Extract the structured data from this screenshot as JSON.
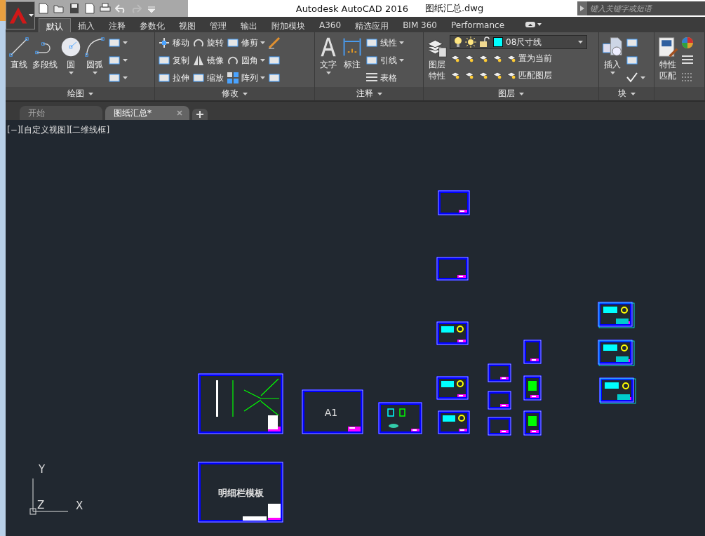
{
  "window": {
    "title": "Autodesk AutoCAD 2016",
    "file_name": "图纸汇总.dwg"
  },
  "search": {
    "placeholder": "键入关键字或短语"
  },
  "ribbon_tabs": [
    {
      "label": "默认",
      "selected": true
    },
    {
      "label": "插入",
      "selected": false
    },
    {
      "label": "注释",
      "selected": false
    },
    {
      "label": "参数化",
      "selected": false
    },
    {
      "label": "视图",
      "selected": false
    },
    {
      "label": "管理",
      "selected": false
    },
    {
      "label": "输出",
      "selected": false
    },
    {
      "label": "附加模块",
      "selected": false
    },
    {
      "label": "A360",
      "selected": false
    },
    {
      "label": "精选应用",
      "selected": false
    },
    {
      "label": "BIM 360",
      "selected": false
    },
    {
      "label": "Performance",
      "selected": false
    }
  ],
  "panels": [
    {
      "title": "绘图",
      "tools": [
        {
          "kind": "large",
          "label": "直线",
          "dropdown": false
        },
        {
          "kind": "large",
          "label": "多段线",
          "dropdown": false
        },
        {
          "kind": "large",
          "label": "圆",
          "dropdown": true
        },
        {
          "kind": "large",
          "label": "圆弧",
          "dropdown": true
        },
        {
          "kind": "icon",
          "dropdown": true
        },
        {
          "kind": "icon",
          "dropdown": true
        },
        {
          "kind": "icon",
          "dropdown": true
        }
      ]
    },
    {
      "title": "修改",
      "tools": [
        {
          "kind": "small",
          "label": "移动",
          "dropdown": false
        },
        {
          "kind": "small",
          "label": "复制",
          "dropdown": false
        },
        {
          "kind": "small",
          "label": "拉伸",
          "dropdown": false
        },
        {
          "kind": "small",
          "label": "旋转",
          "dropdown": false
        },
        {
          "kind": "small",
          "label": "镜像",
          "dropdown": false
        },
        {
          "kind": "small",
          "label": "缩放",
          "dropdown": false
        },
        {
          "kind": "small",
          "label": "修剪",
          "dropdown": true
        },
        {
          "kind": "small",
          "label": "圆角",
          "dropdown": true
        },
        {
          "kind": "small",
          "label": "阵列",
          "dropdown": true
        },
        {
          "kind": "icon",
          "dropdown": false
        },
        {
          "kind": "icon",
          "dropdown": false
        },
        {
          "kind": "icon",
          "dropdown": false
        }
      ]
    },
    {
      "title": "注释",
      "tools": [
        {
          "kind": "large",
          "label": "文字",
          "dropdown": true
        },
        {
          "kind": "large",
          "label": "标注",
          "dropdown": false
        },
        {
          "kind": "small",
          "label": "线性",
          "dropdown": true
        },
        {
          "kind": "small",
          "label": "引线",
          "dropdown": true
        },
        {
          "kind": "small",
          "label": "表格",
          "dropdown": false
        }
      ]
    },
    {
      "title": "图层",
      "layer_selector": {
        "name": "08尺寸线",
        "color": "#00ffff"
      },
      "tools": [
        {
          "kind": "large",
          "label": "图层特性",
          "dropdown": false
        },
        {
          "kind": "icon",
          "dropdown": false
        },
        {
          "kind": "icon",
          "dropdown": false
        },
        {
          "kind": "icon",
          "dropdown": false
        },
        {
          "kind": "icon",
          "dropdown": false
        },
        {
          "kind": "icon",
          "dropdown": false
        },
        {
          "kind": "icon",
          "dropdown": false
        },
        {
          "kind": "icon",
          "dropdown": false
        },
        {
          "kind": "icon",
          "dropdown": false
        },
        {
          "kind": "small",
          "label": "置为当前",
          "dropdown": false
        },
        {
          "kind": "small",
          "label": "匹配图层",
          "dropdown": false
        }
      ]
    },
    {
      "title": "块",
      "tools": [
        {
          "kind": "large",
          "label": "插入",
          "dropdown": true
        },
        {
          "kind": "icon",
          "dropdown": false
        },
        {
          "kind": "icon",
          "dropdown": false
        },
        {
          "kind": "icon",
          "dropdown": true
        }
      ]
    },
    {
      "tools": [
        {
          "kind": "large",
          "label": "特性匹配",
          "dropdown": false
        },
        {
          "kind": "icon",
          "dropdown": false
        },
        {
          "kind": "icon",
          "dropdown": false
        },
        {
          "kind": "icon",
          "dropdown": false
        }
      ]
    }
  ],
  "document_tabs": [
    {
      "label": "开始",
      "selected": false,
      "closable": false
    },
    {
      "label": "图纸汇总*",
      "selected": true,
      "closable": true
    }
  ],
  "viewport": {
    "label": "[−][自定义视图][二维线框]",
    "sheet_titles": [
      "A1",
      "明细栏模板"
    ],
    "ucs_axes": [
      "Y",
      "Z",
      "X"
    ]
  }
}
